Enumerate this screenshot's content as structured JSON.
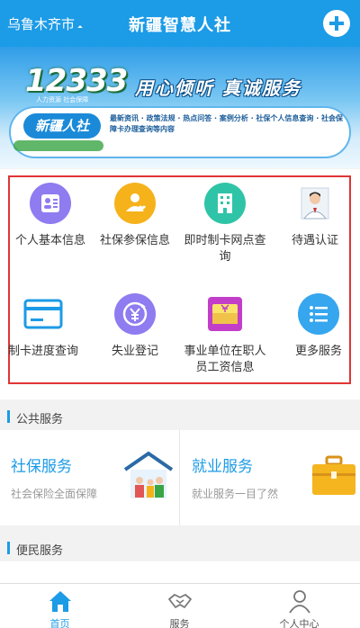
{
  "header": {
    "city": "乌鲁木齐市",
    "title": "新疆智慧人社",
    "add_icon": "plus-circle-icon"
  },
  "banner": {
    "logo_number": "12333",
    "logo_sub": "人力资源 社会保障",
    "slogan": "用心倾听 真诚服务",
    "brand": "新疆人社",
    "description": "最新资讯 · 政策法规 · 热点问答 · 案例分析 · 社保个人信息查询 · 社会保障卡办理查询等内容"
  },
  "grid": [
    {
      "label": "个人基本信息",
      "icon": "id-card-icon",
      "color": "#8e7cf0"
    },
    {
      "label": "社保参保信息",
      "icon": "person-heart-icon",
      "color": "#f5b21a"
    },
    {
      "label": "即时制卡网点查询",
      "icon": "building-icon",
      "color": "#2fc4a7"
    },
    {
      "label": "待遇认证",
      "icon": "face-photo-icon",
      "color": "#ffffff"
    },
    {
      "label": "制卡进度查询",
      "icon": "card-icon",
      "color": "#1c9be6"
    },
    {
      "label": "失业登记",
      "icon": "yuan-refresh-icon",
      "color": "#8e7cf0"
    },
    {
      "label": "事业单位在职人员工资信息",
      "icon": "wallet-icon",
      "color": "#c23ec9"
    },
    {
      "label": "更多服务",
      "icon": "list-icon",
      "color": "#36a6ee"
    }
  ],
  "public_section": {
    "title": "公共服务"
  },
  "services": [
    {
      "name": "社保服务",
      "subtitle": "社会保险全面保障",
      "icon": "family-house-icon"
    },
    {
      "name": "就业服务",
      "subtitle": "就业服务一目了然",
      "icon": "briefcase-icon"
    }
  ],
  "convenience_section": {
    "title": "便民服务"
  },
  "tabs": [
    {
      "label": "首页",
      "icon": "home-icon",
      "active": true
    },
    {
      "label": "服务",
      "icon": "handshake-icon",
      "active": false
    },
    {
      "label": "个人中心",
      "icon": "user-icon",
      "active": false
    }
  ],
  "colors": {
    "primary": "#1c9be6",
    "highlight_border": "#e03535"
  }
}
